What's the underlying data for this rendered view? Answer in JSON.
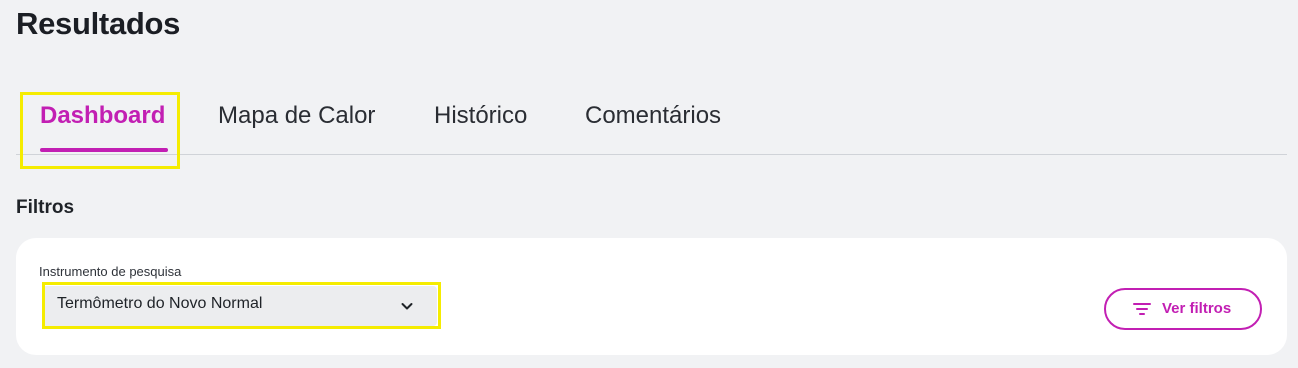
{
  "page": {
    "title": "Resultados"
  },
  "tabs": [
    {
      "label": "Dashboard",
      "active": true
    },
    {
      "label": "Mapa de Calor",
      "active": false
    },
    {
      "label": "Histórico",
      "active": false
    },
    {
      "label": "Comentários",
      "active": false
    }
  ],
  "filters": {
    "section_title": "Filtros",
    "instrument_label": "Instrumento de pesquisa",
    "instrument_value": "Termômetro do Novo Normal",
    "view_filters_label": "Ver filtros"
  },
  "colors": {
    "accent": "#c21fb3",
    "highlight": "#f5ec00",
    "background": "#f1f2f4",
    "card": "#ffffff"
  },
  "icons": {
    "select_chevron": "chevron-down-icon",
    "filter_button": "filter-lines-icon"
  }
}
